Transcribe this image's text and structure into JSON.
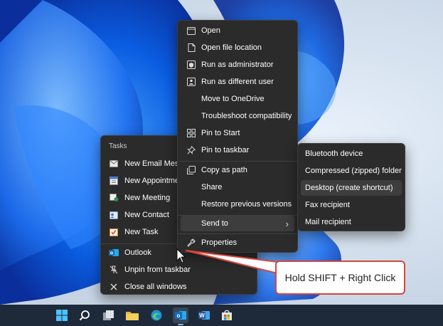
{
  "jumplist": {
    "header": "Tasks",
    "tasks": [
      {
        "label": "New Email Message",
        "icon": "email-icon"
      },
      {
        "label": "New Appointment",
        "icon": "calendar-icon"
      },
      {
        "label": "New Meeting",
        "icon": "meeting-icon"
      },
      {
        "label": "New Contact",
        "icon": "contact-icon"
      },
      {
        "label": "New Task",
        "icon": "task-icon"
      }
    ],
    "app": {
      "label": "Outlook",
      "icon": "outlook-icon"
    },
    "unpin": {
      "label": "Unpin from taskbar",
      "icon": "unpin-icon"
    },
    "close_all": {
      "label": "Close all windows",
      "icon": "close-icon"
    }
  },
  "context_menu": {
    "items": [
      {
        "label": "Open",
        "icon": "window-icon"
      },
      {
        "label": "Open file location",
        "icon": "file-location-icon"
      },
      {
        "label": "Run as administrator",
        "icon": "shield-icon"
      },
      {
        "label": "Run as different user",
        "icon": "user-icon"
      },
      {
        "label": "Move to OneDrive",
        "icon": ""
      },
      {
        "label": "Troubleshoot compatibility",
        "icon": ""
      },
      {
        "label": "Pin to Start",
        "icon": "pin-start-icon"
      },
      {
        "label": "Pin to taskbar",
        "icon": "pin-icon"
      },
      {
        "label": "Copy as path",
        "icon": "copy-icon"
      },
      {
        "label": "Share",
        "icon": ""
      },
      {
        "label": "Restore previous versions",
        "icon": ""
      },
      {
        "label": "Send to",
        "icon": ""
      },
      {
        "label": "Properties",
        "icon": "wrench-icon"
      }
    ],
    "submenu_chevron": "›"
  },
  "send_to_submenu": {
    "items": [
      {
        "label": "Bluetooth device"
      },
      {
        "label": "Compressed (zipped) folder"
      },
      {
        "label": "Desktop (create shortcut)"
      },
      {
        "label": "Fax recipient"
      },
      {
        "label": "Mail recipient"
      }
    ],
    "highlighted_index": 2
  },
  "callout": {
    "text": "Hold SHIFT + Right Click"
  },
  "taskbar": {
    "icons": [
      "windows-start-icon",
      "search-icon",
      "task-view-icon",
      "file-explorer-icon",
      "edge-icon",
      "outlook-icon",
      "word-icon",
      "store-icon"
    ]
  },
  "colors": {
    "menu_bg": "#2b2b2b",
    "highlight": "#3d3d3d",
    "callout_border": "#d9453a",
    "outlook_blue": "#0f6cbd",
    "word_blue": "#2b579a"
  }
}
